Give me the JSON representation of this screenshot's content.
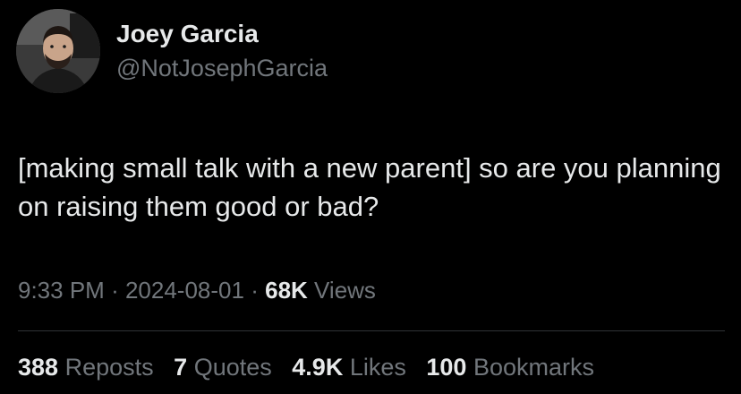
{
  "author": {
    "display_name": "Joey Garcia",
    "handle": "@NotJosephGarcia"
  },
  "tweet": {
    "text": "[making small talk with a new parent] so are you planning on raising them good or bad?"
  },
  "meta": {
    "time": "9:33 PM",
    "separator": "·",
    "date": "2024-08-01",
    "views_count": "68K",
    "views_label": "Views"
  },
  "stats": {
    "reposts": {
      "count": "388",
      "label": "Reposts"
    },
    "quotes": {
      "count": "7",
      "label": "Quotes"
    },
    "likes": {
      "count": "4.9K",
      "label": "Likes"
    },
    "bookmarks": {
      "count": "100",
      "label": "Bookmarks"
    }
  },
  "colors": {
    "background": "#000000",
    "primary_text": "#e7e9ea",
    "secondary_text": "#71767b",
    "divider": "#2f3336"
  }
}
